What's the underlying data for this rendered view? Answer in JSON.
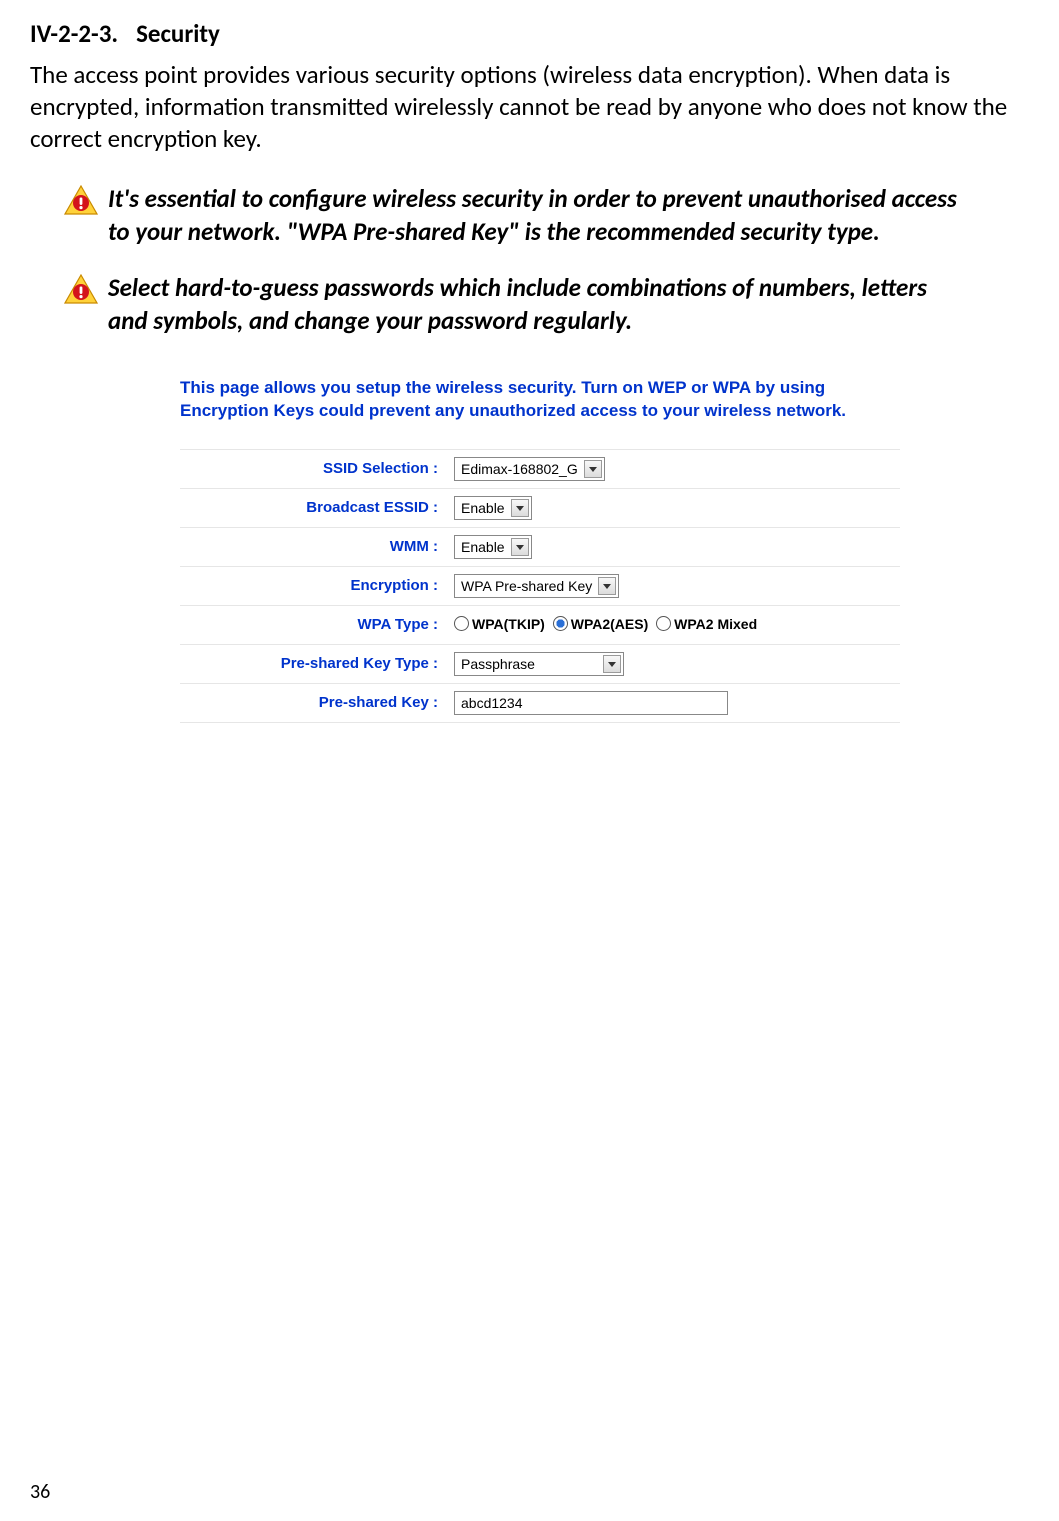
{
  "heading": {
    "number": "IV-2-2-3.",
    "title": "Security"
  },
  "intro": "The access point provides various security options (wireless data encryption). When data is encrypted, information transmitted wirelessly cannot be read by anyone who does not know the correct encryption key.",
  "callouts": [
    "It's essential to configure wireless security in order to prevent unauthorised access to your network. \"WPA Pre-shared Key\" is the recommended security type.",
    "Select hard-to-guess passwords which include combinations of numbers, letters and symbols, and change your password regularly."
  ],
  "form": {
    "intro": "This page allows you setup the wireless security. Turn on WEP or WPA by using Encryption Keys could prevent any unauthorized access to your wireless network.",
    "rows": {
      "ssid": {
        "label": "SSID Selection :",
        "value": "Edimax-168802_G"
      },
      "broadcast": {
        "label": "Broadcast ESSID :",
        "value": "Enable"
      },
      "wmm": {
        "label": "WMM :",
        "value": "Enable"
      },
      "encryption": {
        "label": "Encryption :",
        "value": "WPA Pre-shared Key"
      },
      "wpatype": {
        "label": "WPA Type :",
        "options": [
          "WPA(TKIP)",
          "WPA2(AES)",
          "WPA2 Mixed"
        ],
        "selected": "WPA2(AES)"
      },
      "keytype": {
        "label": "Pre-shared Key Type :",
        "value": "Passphrase"
      },
      "key": {
        "label": "Pre-shared Key :",
        "value": "abcd1234"
      }
    }
  },
  "page_number": "36"
}
